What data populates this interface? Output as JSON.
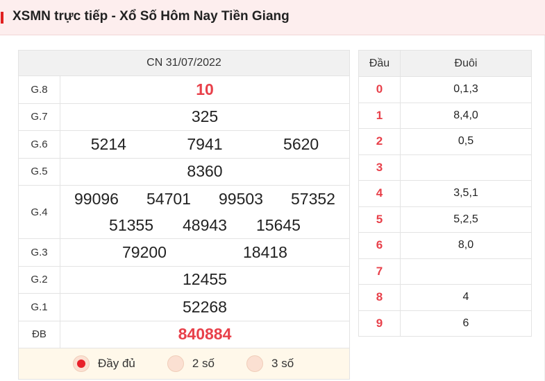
{
  "header": {
    "title": "XSMN trực tiếp - Xổ Số Hôm Nay Tiền Giang"
  },
  "results": {
    "date": "CN 31/07/2022",
    "prizes": [
      {
        "label": "G.8",
        "rows": [
          [
            "10"
          ]
        ],
        "highlight": true
      },
      {
        "label": "G.7",
        "rows": [
          [
            "325"
          ]
        ]
      },
      {
        "label": "G.6",
        "rows": [
          [
            "5214",
            "7941",
            "5620"
          ]
        ]
      },
      {
        "label": "G.5",
        "rows": [
          [
            "8360"
          ]
        ]
      },
      {
        "label": "G.4",
        "rows": [
          [
            "99096",
            "54701",
            "99503",
            "57352"
          ],
          [
            "51355",
            "48943",
            "15645"
          ]
        ]
      },
      {
        "label": "G.3",
        "rows": [
          [
            "79200",
            "18418"
          ]
        ]
      },
      {
        "label": "G.2",
        "rows": [
          [
            "12455"
          ]
        ]
      },
      {
        "label": "G.1",
        "rows": [
          [
            "52268"
          ]
        ]
      },
      {
        "label": "ĐB",
        "rows": [
          [
            "840884"
          ]
        ],
        "highlight": true
      }
    ],
    "options": [
      {
        "label": "Đầy đủ",
        "selected": true
      },
      {
        "label": "2 số",
        "selected": false
      },
      {
        "label": "3 số",
        "selected": false
      }
    ]
  },
  "loto": {
    "head_label": "Đầu",
    "tail_label": "Đuôi",
    "rows": [
      {
        "head": "0",
        "tail": "0,1,3"
      },
      {
        "head": "1",
        "tail": "8,4,0"
      },
      {
        "head": "2",
        "tail": "0,5"
      },
      {
        "head": "3",
        "tail": ""
      },
      {
        "head": "4",
        "tail": "3,5,1"
      },
      {
        "head": "5",
        "tail": "5,2,5"
      },
      {
        "head": "6",
        "tail": "8,0"
      },
      {
        "head": "7",
        "tail": ""
      },
      {
        "head": "8",
        "tail": "4"
      },
      {
        "head": "9",
        "tail": "6"
      }
    ]
  },
  "colors": {
    "accent": "#e8404a",
    "header_bg": "#fdeeee",
    "options_bg": "#fff8ea"
  }
}
